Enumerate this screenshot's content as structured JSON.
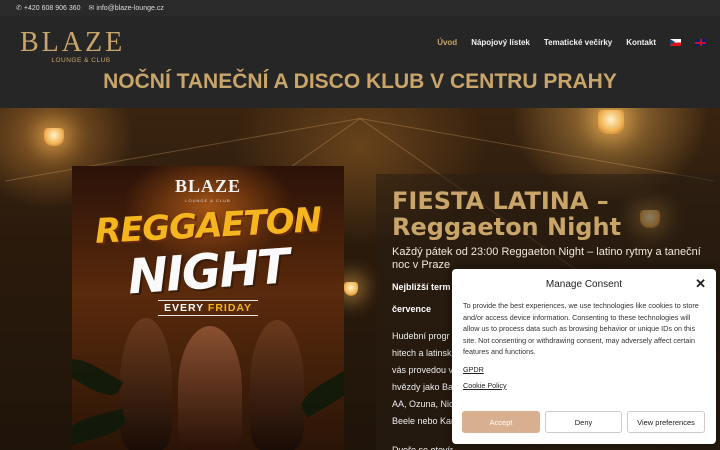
{
  "topbar": {
    "phone": "+420 608 906 360",
    "email": "info@blaze-lounge.cz"
  },
  "logo": {
    "main": "BLAZE",
    "sub": "LOUNGE & CLUB"
  },
  "nav": {
    "items": [
      "Úvod",
      "Nápojový lístek",
      "Tematické večírky",
      "Kontakt"
    ],
    "active": "Úvod"
  },
  "headline": "NOČNÍ TANEČNÍ A DISCO KLUB V CENTRU PRAHY",
  "poster": {
    "logo": "BLAZE",
    "logo_sub": "LOUNGE & CLUB",
    "title1": "REGGAETON",
    "title2": "NIGHT",
    "tag_prefix": "EVERY ",
    "tag_day": "FRIDAY"
  },
  "card": {
    "title": "FIESTA LATINA – Reggaeton Night",
    "subtitle": "Každý pátek od 23:00 Reggaeton Night – latino rytmy a taneční noc v Praze",
    "strong1": "Nejbližší term",
    "strong2": "července",
    "body_lines": [
      "Hudební progr",
      "hitech a latinsk",
      "vás provedou v",
      "hvězdy jako Ba",
      "AA, Ozuna, Nic",
      "Beele nebo Kar"
    ],
    "body2": "Dveře se otevír"
  },
  "consent": {
    "title": "Manage Consent",
    "text": "To provide the best experiences, we use technologies like cookies to store and/or access device information. Consenting to these technologies will allow us to process data such as browsing behavior or unique IDs on this site. Not consenting or withdrawing consent, may adversely affect certain features and functions.",
    "link1": "GPDR",
    "link2": "Cookie Policy",
    "accept": "Accept",
    "deny": "Deny",
    "preferences": "View preferences"
  },
  "colors": {
    "gold": "#c9a56a",
    "accept_bg": "#d8b090"
  }
}
